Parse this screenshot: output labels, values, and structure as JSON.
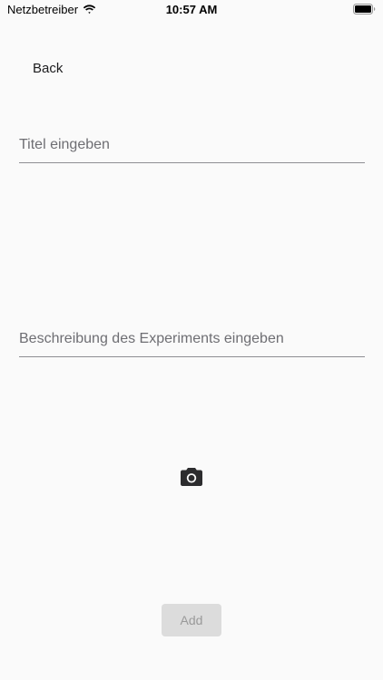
{
  "status_bar": {
    "carrier": "Netzbetreiber",
    "time": "10:57 AM",
    "wifi_icon": "wifi-icon",
    "battery_icon": "battery-icon"
  },
  "nav": {
    "back_label": "Back"
  },
  "form": {
    "title_placeholder": "Titel eingeben",
    "title_value": "",
    "description_placeholder": "Beschreibung des Experiments eingeben",
    "description_value": "",
    "camera_icon": "camera-icon",
    "add_label": "Add",
    "add_enabled": false
  },
  "colors": {
    "background": "#fafafa",
    "underline": "#8e8e93",
    "placeholder": "#6e6e73",
    "disabled_button_bg": "#dcdcdc",
    "disabled_button_text": "#9a9a9a"
  }
}
